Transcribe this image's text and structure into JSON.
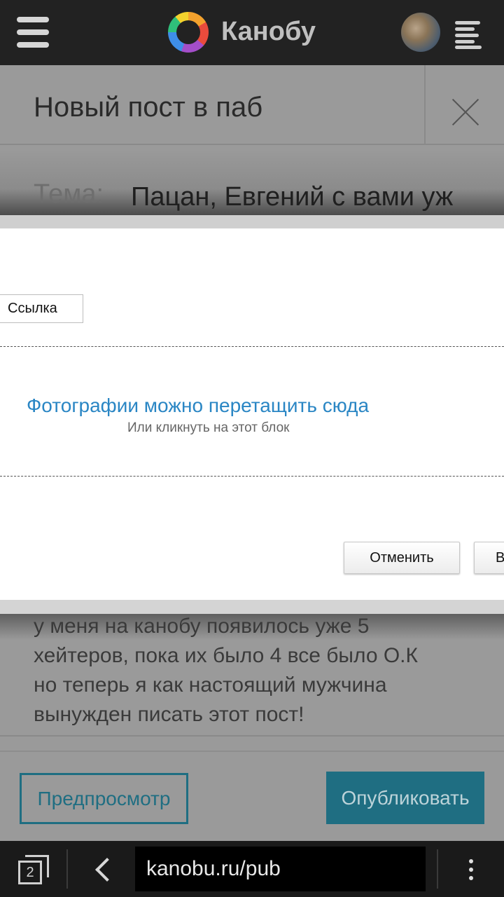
{
  "header": {
    "brand": "Канобу",
    "menu_icon": "hamburger-icon",
    "logo_icon": "kanobu-ring-logo",
    "avatar": "user-avatar",
    "list_icon": "list-icon"
  },
  "post": {
    "title": "Новый пост в паб",
    "close_icon": "close-icon",
    "topic_label": "Тема:",
    "topic_value": "Пацан, Евгений с вами уж",
    "body_lines": [
      "у меня на канобу появилось уже 5",
      "хейтеров, пока их было 4 все было О.К",
      "но теперь я как настоящий мужчина",
      "вынужден писать этот пост!"
    ],
    "preview_label": "Предпросмотр",
    "publish_label": "Опубликовать"
  },
  "modal": {
    "link_tab": "Ссылка",
    "drop_main": "Фотографии можно перетащить сюда",
    "drop_sub": "Или кликнуть на этот блок",
    "cancel_label": "Отменить",
    "second_label": "В"
  },
  "browser": {
    "tab_count": "2",
    "url": "kanobu.ru/pub",
    "back_icon": "back-arrow-icon",
    "menu_icon": "kebab-menu-icon"
  },
  "colors": {
    "accent": "#1f6e82",
    "link_blue": "#2a86c4",
    "header_bg": "#222222"
  }
}
